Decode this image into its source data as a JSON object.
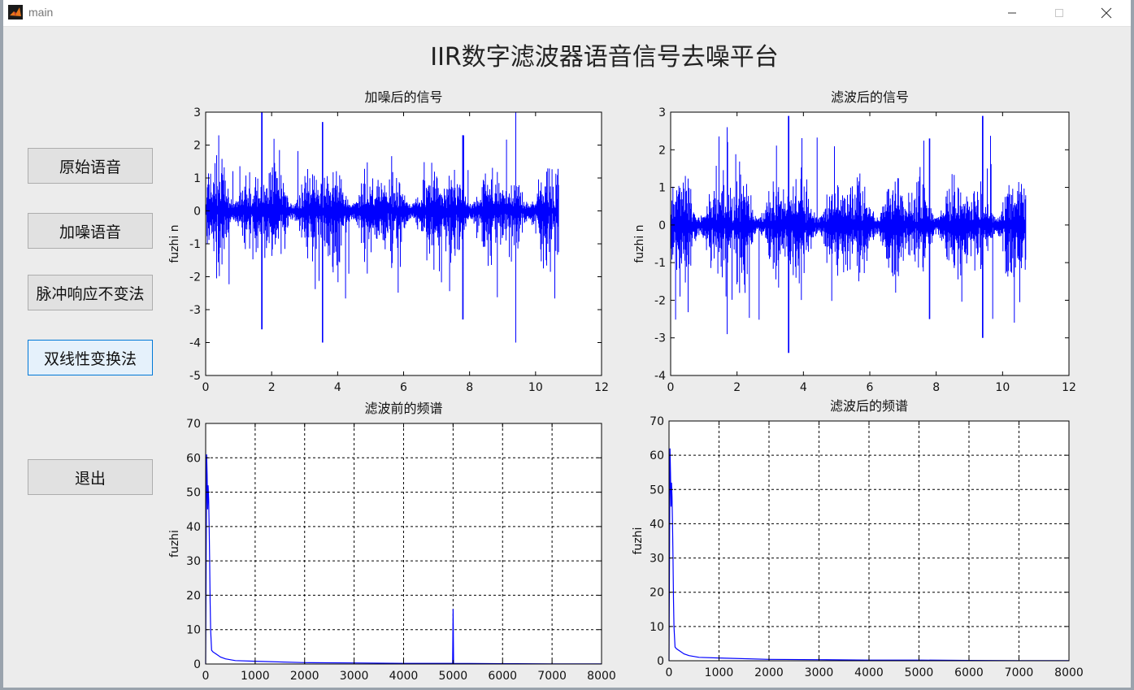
{
  "window": {
    "title": "main",
    "minimize_icon": "minimize-icon",
    "maximize_icon": "maximize-icon",
    "close_icon": "close-icon",
    "app_icon": "matlab-icon"
  },
  "page_title": "IIR数字滤波器语音信号去噪平台",
  "buttons": {
    "original": "原始语音",
    "noisy": "加噪语音",
    "impulse": "脉冲响应不变法",
    "bilinear": "双线性变换法",
    "exit": "退出"
  },
  "colors": {
    "signal": "#0000ff",
    "axes": "#000000",
    "background": "#ececec",
    "button_focus_border": "#0078d7"
  },
  "chart_data": [
    {
      "type": "line",
      "title": "加噪后的信号",
      "xlabel": "",
      "ylabel": "fuzhi n",
      "xlim": [
        0,
        12
      ],
      "ylim": [
        -5,
        3
      ],
      "xticks": [
        "0",
        "2",
        "4",
        "6",
        "8",
        "10",
        "12"
      ],
      "yticks": [
        "-5",
        "-4",
        "-3",
        "-2",
        "-1",
        "0",
        "1",
        "2",
        "3"
      ],
      "grid": false,
      "signal_end": 10.7,
      "peak_events": [
        {
          "x": 1.7,
          "max": 3.0,
          "min": -3.6
        },
        {
          "x": 3.55,
          "max": 2.7,
          "min": -4.0
        },
        {
          "x": 7.8,
          "max": 2.3,
          "min": -3.3
        },
        {
          "x": 9.4,
          "max": 3.0,
          "min": -4.0
        }
      ]
    },
    {
      "type": "line",
      "title": "滤波后的信号",
      "xlabel": "",
      "ylabel": "fuzhi n",
      "xlim": [
        0,
        12
      ],
      "ylim": [
        -4,
        3
      ],
      "xticks": [
        "0",
        "2",
        "4",
        "6",
        "8",
        "10",
        "12"
      ],
      "yticks": [
        "-4",
        "-3",
        "-2",
        "-1",
        "0",
        "1",
        "2",
        "3"
      ],
      "grid": false,
      "signal_end": 10.7,
      "peak_events": [
        {
          "x": 1.7,
          "max": 2.6,
          "min": -2.9
        },
        {
          "x": 3.55,
          "max": 2.9,
          "min": -3.4
        },
        {
          "x": 7.8,
          "max": 2.3,
          "min": -2.5
        },
        {
          "x": 9.4,
          "max": 2.9,
          "min": -3.0
        }
      ]
    },
    {
      "type": "line",
      "title": "滤波前的频谱",
      "xlabel": "",
      "ylabel": "fuzhi",
      "xlim": [
        0,
        8000
      ],
      "ylim": [
        0,
        70
      ],
      "xticks": [
        "0",
        "1000",
        "2000",
        "3000",
        "4000",
        "5000",
        "6000",
        "7000",
        "8000"
      ],
      "yticks": [
        "0",
        "10",
        "20",
        "30",
        "40",
        "50",
        "60",
        "70"
      ],
      "grid": true,
      "spectrum": [
        [
          0,
          0
        ],
        [
          10,
          30
        ],
        [
          20,
          61
        ],
        [
          30,
          55
        ],
        [
          40,
          45
        ],
        [
          50,
          52
        ],
        [
          60,
          48
        ],
        [
          70,
          40
        ],
        [
          80,
          30
        ],
        [
          90,
          18
        ],
        [
          100,
          10
        ],
        [
          120,
          4
        ],
        [
          150,
          3.5
        ],
        [
          200,
          3
        ],
        [
          300,
          2
        ],
        [
          400,
          1.5
        ],
        [
          600,
          1
        ],
        [
          1000,
          0.8
        ],
        [
          2000,
          0.4
        ],
        [
          3000,
          0.3
        ],
        [
          4000,
          0.2
        ],
        [
          4990,
          0.2
        ],
        [
          5000,
          16
        ],
        [
          5010,
          0.2
        ],
        [
          6000,
          0.1
        ],
        [
          7000,
          0.05
        ],
        [
          8000,
          0.05
        ]
      ]
    },
    {
      "type": "line",
      "title": "滤波后的频谱",
      "xlabel": "",
      "ylabel": "fuzhi",
      "xlim": [
        0,
        8000
      ],
      "ylim": [
        0,
        70
      ],
      "xticks": [
        "0",
        "1000",
        "2000",
        "3000",
        "4000",
        "5000",
        "6000",
        "7000",
        "8000"
      ],
      "yticks": [
        "0",
        "10",
        "20",
        "30",
        "40",
        "50",
        "60",
        "70"
      ],
      "grid": true,
      "spectrum": [
        [
          0,
          0
        ],
        [
          10,
          30
        ],
        [
          20,
          62
        ],
        [
          30,
          55
        ],
        [
          40,
          45
        ],
        [
          50,
          52
        ],
        [
          60,
          48
        ],
        [
          70,
          40
        ],
        [
          80,
          30
        ],
        [
          90,
          18
        ],
        [
          100,
          10
        ],
        [
          120,
          4
        ],
        [
          150,
          3.5
        ],
        [
          200,
          3
        ],
        [
          300,
          2
        ],
        [
          400,
          1.5
        ],
        [
          600,
          1
        ],
        [
          1000,
          0.8
        ],
        [
          2000,
          0.4
        ],
        [
          3000,
          0.3
        ],
        [
          4000,
          0.2
        ],
        [
          5000,
          0.2
        ],
        [
          6000,
          0.1
        ],
        [
          7000,
          0.05
        ],
        [
          8000,
          0.05
        ]
      ]
    }
  ]
}
